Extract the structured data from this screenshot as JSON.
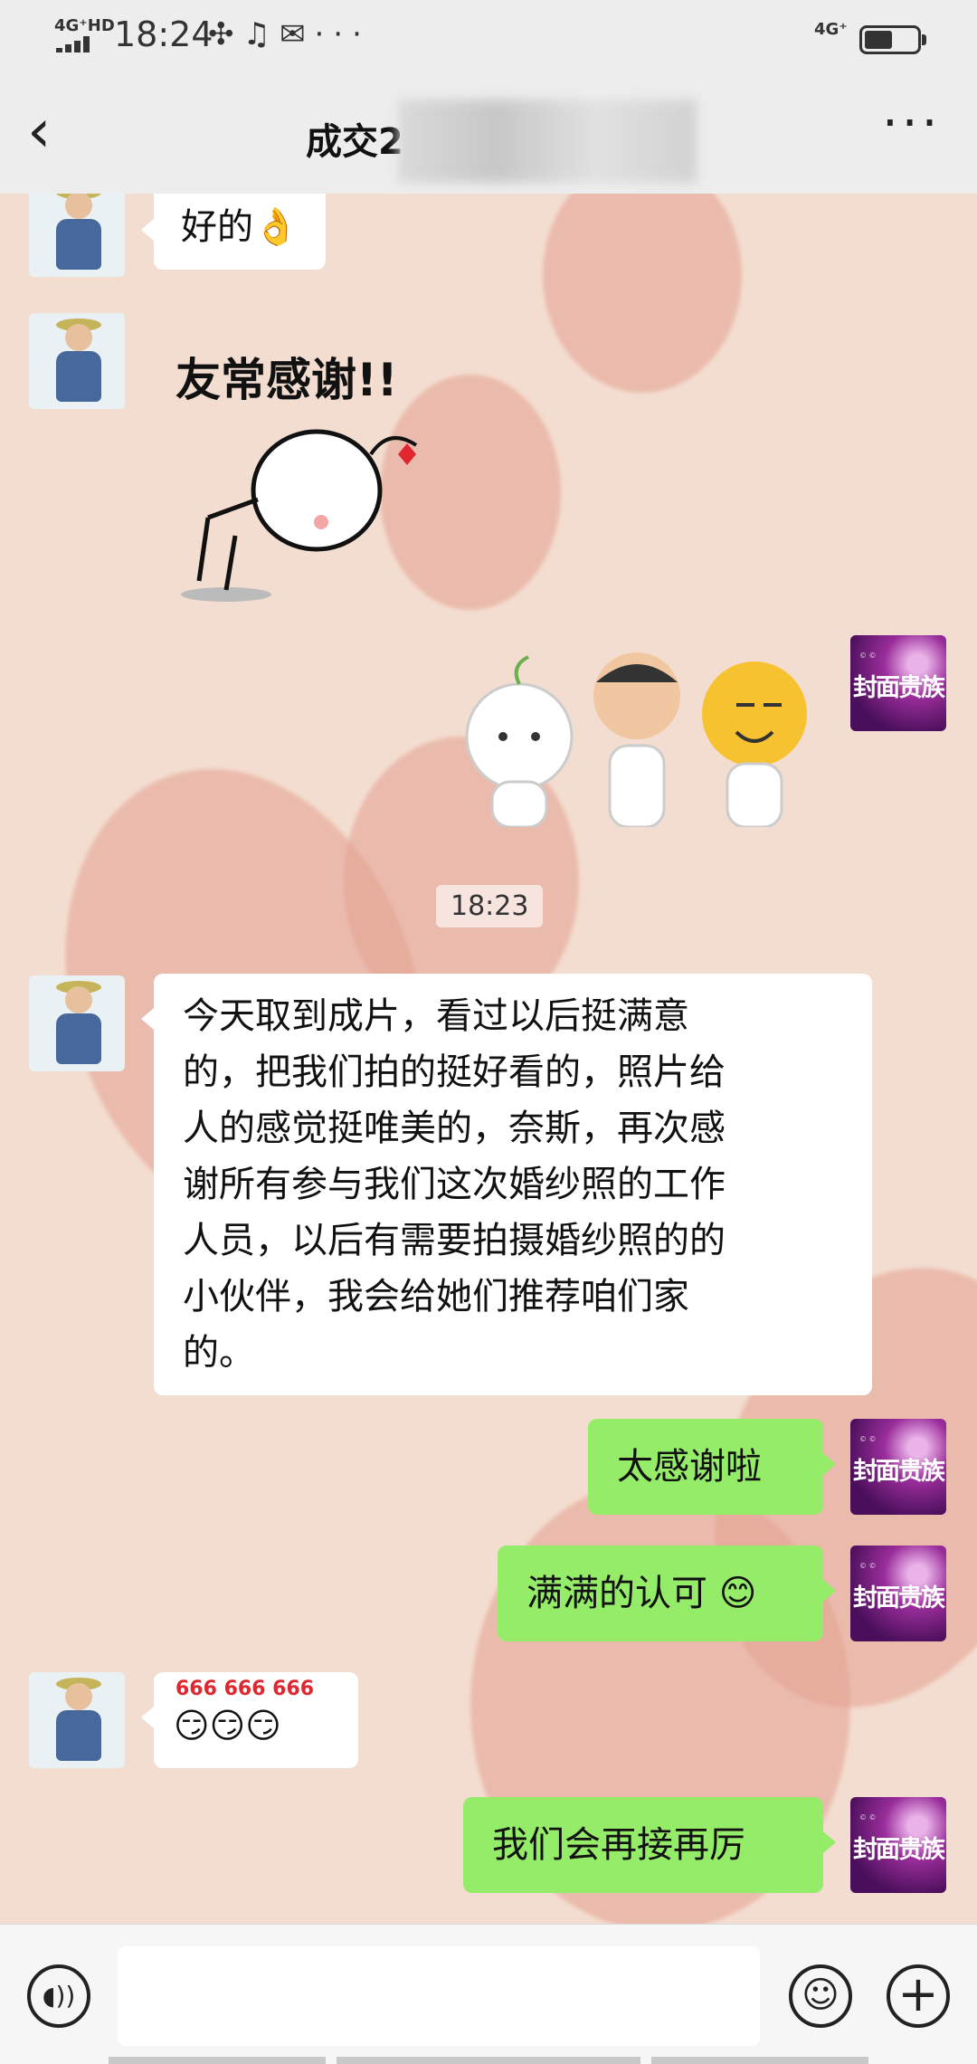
{
  "status_bar": {
    "network_left": "4G⁺HD",
    "time": "18:24",
    "notification_icons": [
      "pinwheel-icon",
      "music-note-icon",
      "mail-icon",
      "more-dots-icon"
    ],
    "network_right": "4G⁺"
  },
  "header": {
    "title": "成交2",
    "back_icon": "chevron-left-icon",
    "more_icon": "more-horizontal-icon"
  },
  "messages": [
    {
      "side": "left",
      "type": "text",
      "text": "好的👌"
    },
    {
      "side": "left",
      "type": "sticker",
      "text": "友常感谢!!"
    },
    {
      "side": "right",
      "type": "sticker",
      "text": ""
    },
    {
      "type": "timestamp",
      "text": "18:23"
    },
    {
      "side": "left",
      "type": "text",
      "lines": [
        "今天取到成片，看过以后挺满意",
        "的，把我们拍的挺好看的，照片给",
        "人的感觉挺唯美的，奈斯，再次感",
        "谢所有参与我们这次婚纱照的工作",
        "人员，以后有需要拍摄婚纱照的的",
        "小伙伴，我会给她们推荐咱们家",
        "的。"
      ]
    },
    {
      "side": "right",
      "type": "text",
      "text": "太感谢啦"
    },
    {
      "side": "right",
      "type": "text",
      "text": "满满的认可 😊"
    },
    {
      "side": "left",
      "type": "emoji",
      "text": "666 666 666"
    },
    {
      "side": "right",
      "type": "text",
      "text": "我们会再接再厉"
    }
  ],
  "avatars": {
    "right_brand": "封面贵族"
  },
  "bottom_bar": {
    "voice_icon": "voice-icon",
    "emoji_icon": "emoji-icon",
    "plus_icon": "plus-icon"
  }
}
